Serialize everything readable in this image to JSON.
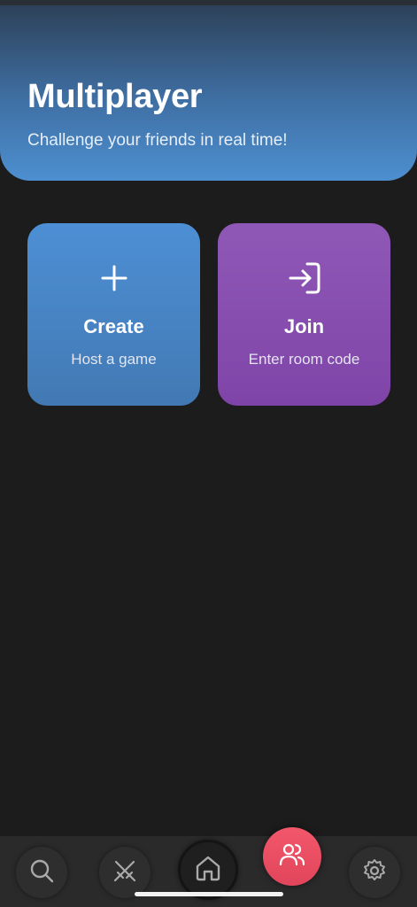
{
  "header": {
    "title": "Multiplayer",
    "subtitle": "Challenge your friends in real time!"
  },
  "actions": [
    {
      "title": "Create",
      "subtitle": "Host a game",
      "icon": "plus-icon",
      "color_top": "#4d8fd4",
      "color_bottom": "#4279b4"
    },
    {
      "title": "Join",
      "subtitle": "Enter room code",
      "icon": "login-arrow-icon",
      "color_top": "#8f58b6",
      "color_bottom": "#7f44a8"
    }
  ],
  "nav": {
    "items": [
      {
        "icon": "search-icon"
      },
      {
        "icon": "crossed-swords-icon"
      },
      {
        "icon": "home-icon"
      },
      {
        "icon": "users-icon",
        "active": true
      },
      {
        "icon": "gear-icon"
      }
    ],
    "active_color": "#ea4d63"
  },
  "colors": {
    "background": "#1c1c1c",
    "header_gradient_top": "#2c3f55",
    "header_gradient_bottom": "#4d8fd0"
  }
}
